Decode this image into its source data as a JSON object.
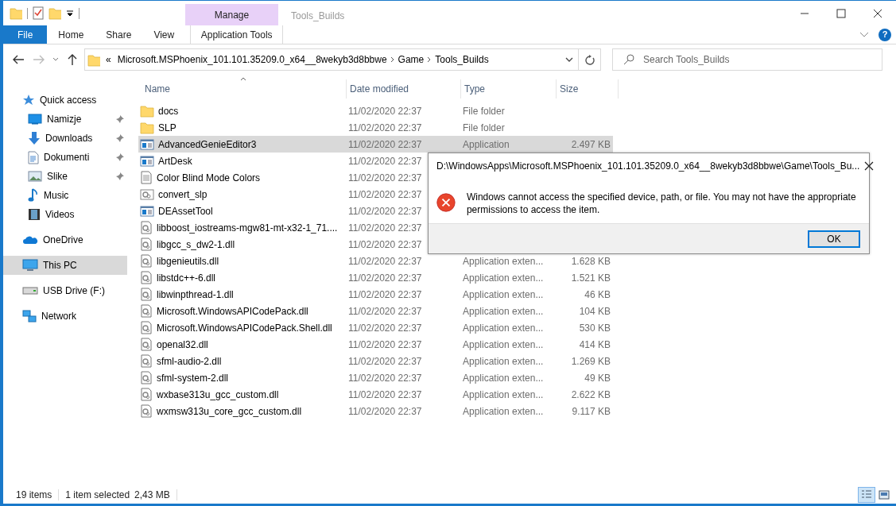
{
  "window": {
    "title": "Tools_Builds"
  },
  "ribbon": {
    "context_group": "Manage",
    "tabs": [
      {
        "label": "File",
        "kind": "file",
        "selected": false
      },
      {
        "label": "Home",
        "kind": "plain",
        "selected": false
      },
      {
        "label": "Share",
        "kind": "plain",
        "selected": false
      },
      {
        "label": "View",
        "kind": "plain",
        "selected": false
      },
      {
        "label": "Application Tools",
        "kind": "context",
        "selected": false
      }
    ],
    "help": "?"
  },
  "address_bar": {
    "overflow": "«",
    "crumbs": [
      "Microsoft.MSPhoenix_101.101.35209.0_x64__8wekyb3d8bbwe",
      "Game",
      "Tools_Builds"
    ]
  },
  "search": {
    "placeholder": "Search Tools_Builds"
  },
  "sidebar": {
    "items": [
      {
        "label": "Quick access",
        "kind": "star",
        "selected": false,
        "children": [
          {
            "label": "Namizje",
            "kind": "desktop",
            "pinned": true,
            "selected": false
          },
          {
            "label": "Downloads",
            "kind": "download",
            "pinned": true,
            "selected": false
          },
          {
            "label": "Dokumenti",
            "kind": "document",
            "pinned": true,
            "selected": false
          },
          {
            "label": "Slike",
            "kind": "pictures",
            "pinned": true,
            "selected": false
          },
          {
            "label": "Music",
            "kind": "music",
            "pinned": false,
            "selected": false
          },
          {
            "label": "Videos",
            "kind": "videos",
            "pinned": false,
            "selected": false
          }
        ]
      },
      {
        "label": "OneDrive",
        "kind": "cloud",
        "selected": false
      },
      {
        "label": "This PC",
        "kind": "pc",
        "selected": true
      },
      {
        "label": "USB Drive (F:)",
        "kind": "usb",
        "selected": false
      },
      {
        "label": "Network",
        "kind": "network",
        "selected": false
      }
    ]
  },
  "table": {
    "columns": [
      "Name",
      "Date modified",
      "Type",
      "Size"
    ],
    "rows": [
      {
        "kind": "folder",
        "name": "docs",
        "date": "11/02/2020 22:37",
        "type": "File folder",
        "selected": false
      },
      {
        "kind": "folder",
        "name": "SLP",
        "date": "11/02/2020 22:37",
        "type": "File folder",
        "selected": false
      },
      {
        "kind": "app",
        "name": "AdvancedGenieEditor3",
        "date": "11/02/2020 22:37",
        "type": "Application",
        "size": "2.497 KB",
        "selected": true
      },
      {
        "kind": "app",
        "name": "ArtDesk",
        "date": "11/02/2020 22:37",
        "selected": false
      },
      {
        "kind": "text",
        "name": "Color Blind Mode Colors",
        "date": "11/02/2020 22:37",
        "selected": false
      },
      {
        "kind": "config",
        "name": "convert_slp",
        "date": "11/02/2020 22:37",
        "selected": false
      },
      {
        "kind": "app",
        "name": "DEAssetTool",
        "date": "11/02/2020 22:37",
        "selected": false
      },
      {
        "kind": "dll",
        "name": "libboost_iostreams-mgw81-mt-x32-1_71....",
        "date": "11/02/2020 22:37",
        "selected": false
      },
      {
        "kind": "dll",
        "name": "libgcc_s_dw2-1.dll",
        "date": "11/02/2020 22:37",
        "selected": false
      },
      {
        "kind": "dll",
        "name": "libgenieutils.dll",
        "date": "11/02/2020 22:37",
        "type": "Application exten...",
        "size": "1.628 KB",
        "selected": false
      },
      {
        "kind": "dll",
        "name": "libstdc++-6.dll",
        "date": "11/02/2020 22:37",
        "type": "Application exten...",
        "size": "1.521 KB",
        "selected": false
      },
      {
        "kind": "dll",
        "name": "libwinpthread-1.dll",
        "date": "11/02/2020 22:37",
        "type": "Application exten...",
        "size": "46 KB",
        "selected": false
      },
      {
        "kind": "dll",
        "name": "Microsoft.WindowsAPICodePack.dll",
        "date": "11/02/2020 22:37",
        "type": "Application exten...",
        "size": "104 KB",
        "selected": false
      },
      {
        "kind": "dll",
        "name": "Microsoft.WindowsAPICodePack.Shell.dll",
        "date": "11/02/2020 22:37",
        "type": "Application exten...",
        "size": "530 KB",
        "selected": false
      },
      {
        "kind": "dll",
        "name": "openal32.dll",
        "date": "11/02/2020 22:37",
        "type": "Application exten...",
        "size": "414 KB",
        "selected": false
      },
      {
        "kind": "dll",
        "name": "sfml-audio-2.dll",
        "date": "11/02/2020 22:37",
        "type": "Application exten...",
        "size": "1.269 KB",
        "selected": false
      },
      {
        "kind": "dll",
        "name": "sfml-system-2.dll",
        "date": "11/02/2020 22:37",
        "type": "Application exten...",
        "size": "49 KB",
        "selected": false
      },
      {
        "kind": "dll",
        "name": "wxbase313u_gcc_custom.dll",
        "date": "11/02/2020 22:37",
        "type": "Application exten...",
        "size": "2.622 KB",
        "selected": false
      },
      {
        "kind": "dll",
        "name": "wxmsw313u_core_gcc_custom.dll",
        "date": "11/02/2020 22:37",
        "type": "Application exten...",
        "size": "9.117 KB",
        "selected": false
      }
    ]
  },
  "status_bar": {
    "items_count": "19 items",
    "selection": "1 item selected",
    "selection_size": "2,43 MB",
    "views": [
      {
        "kind": "details",
        "selected": true
      },
      {
        "kind": "large_icons",
        "selected": false
      }
    ]
  },
  "dialog": {
    "title": "D:\\WindowsApps\\Microsoft.MSPhoenix_101.101.35209.0_x64__8wekyb3d8bbwe\\Game\\Tools_Bu...",
    "message": "Windows cannot access the specified device, path, or file. You may not have the appropriate permissions to access the item.",
    "button": "OK"
  }
}
